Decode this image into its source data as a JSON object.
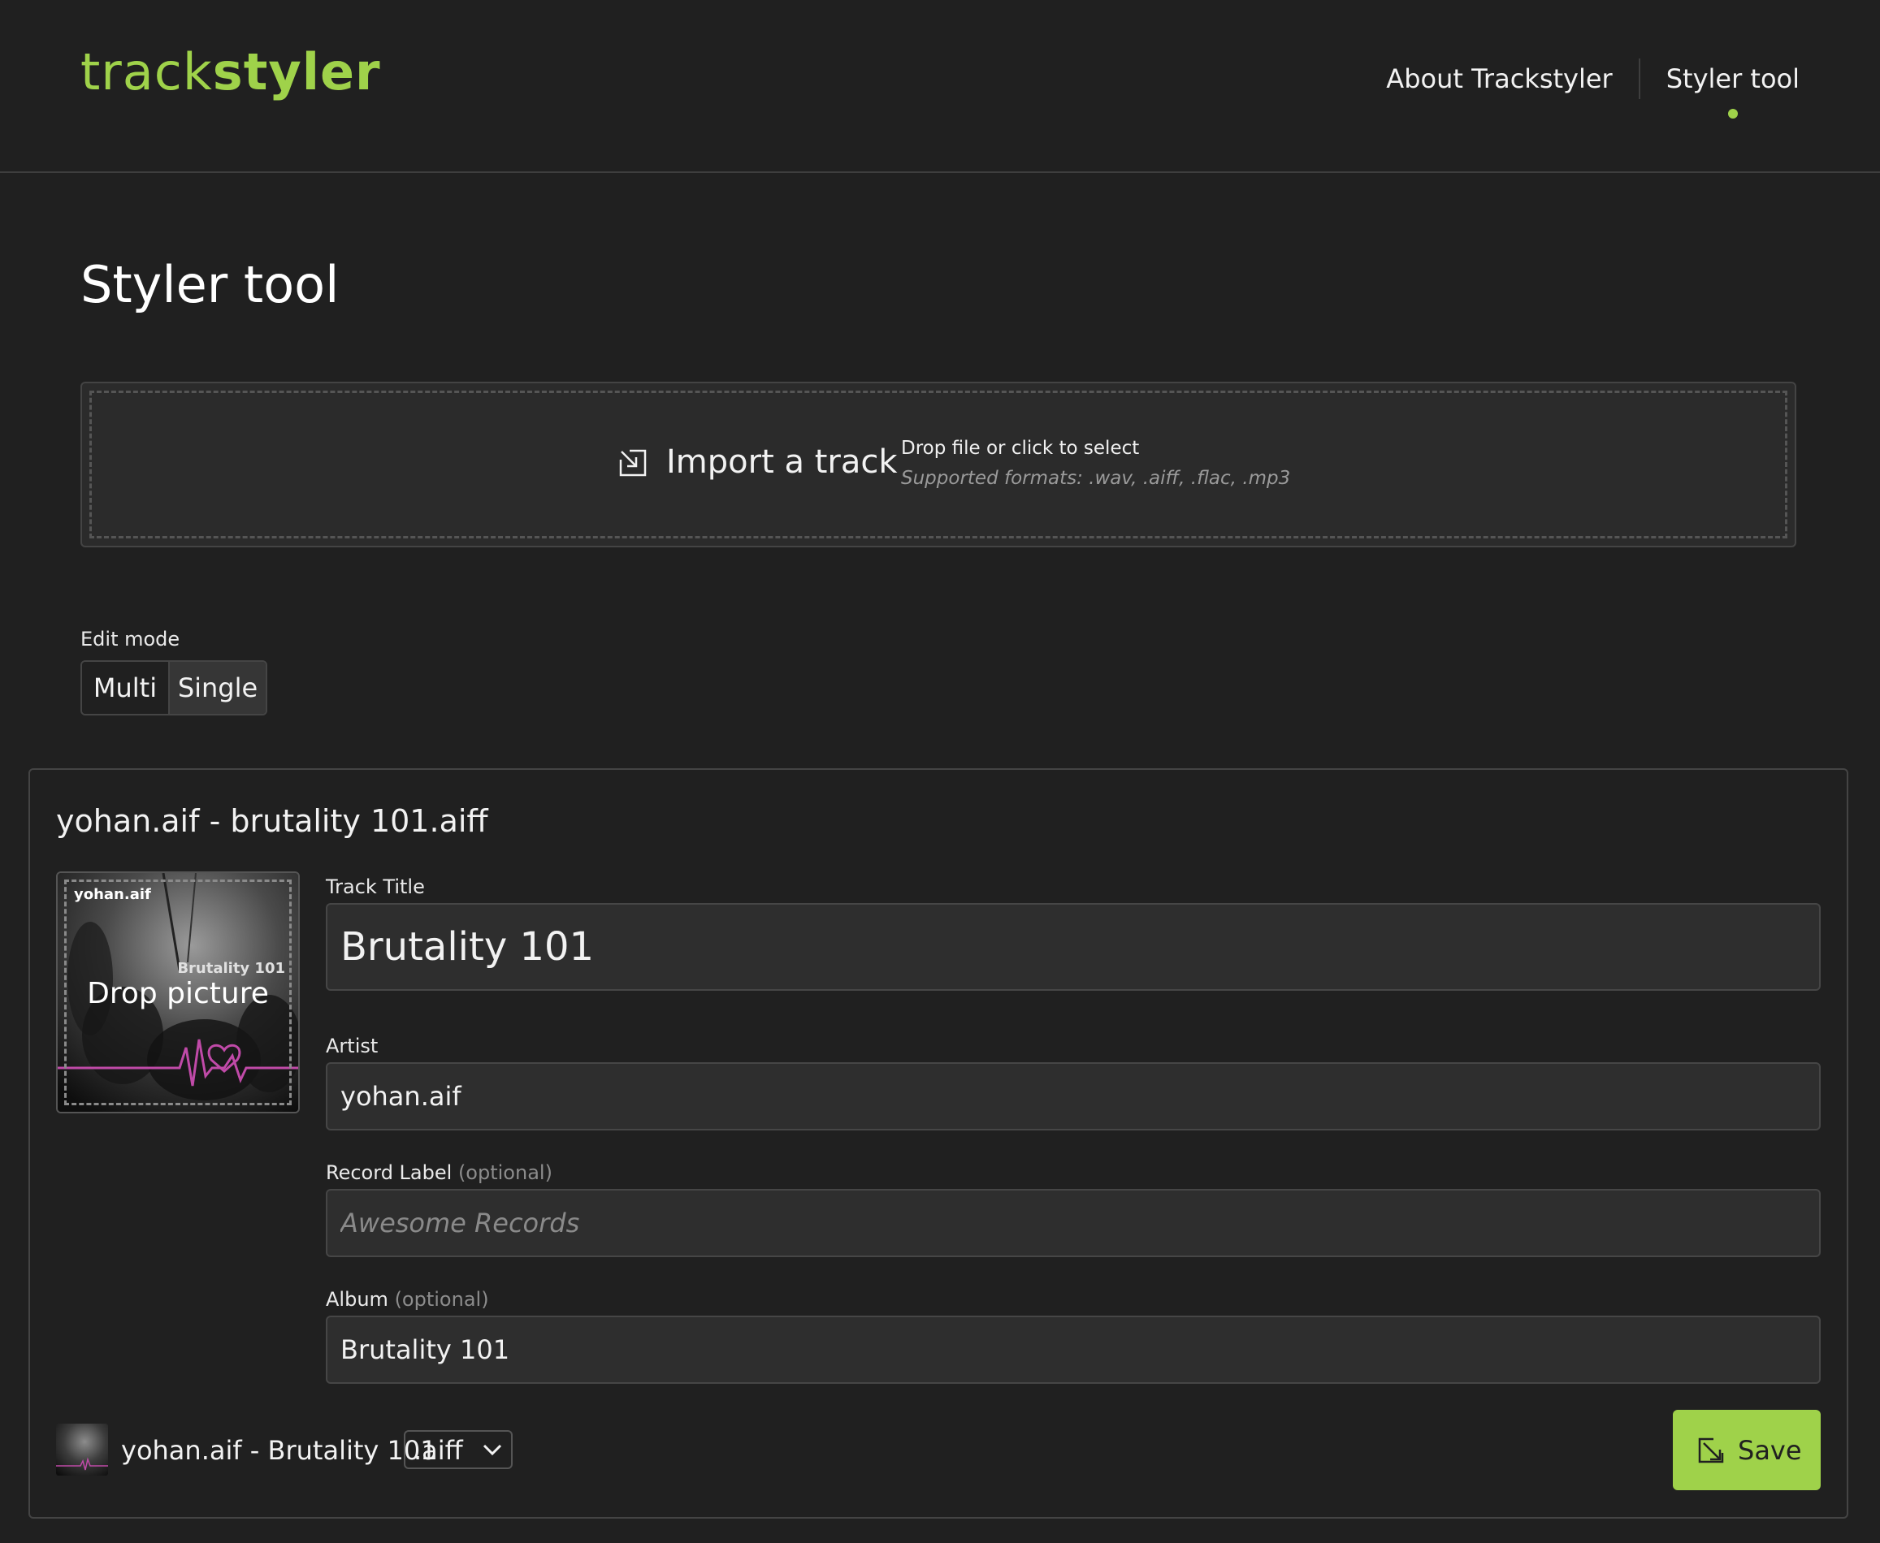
{
  "header": {
    "logo_light": "track",
    "logo_bold": "styler",
    "nav": [
      {
        "label": "About Trackstyler",
        "active": false
      },
      {
        "label": "Styler tool",
        "active": true
      }
    ],
    "accent_color": "#9fd24a"
  },
  "page": {
    "title": "Styler tool"
  },
  "import": {
    "icon": "import-icon",
    "label": "Import a track",
    "hint": "Drop file or click to select",
    "formats": "Supported formats: .wav, .aiff, .flac, .mp3"
  },
  "edit_mode": {
    "label": "Edit mode",
    "options": [
      "Multi",
      "Single"
    ],
    "selected": "Single"
  },
  "track": {
    "file_name": "yohan.aif - brutality 101.aiff",
    "cover": {
      "artist_text": "yohan.aif",
      "album_text": "Brutality 101",
      "drop_label": "Drop picture"
    },
    "fields": {
      "title": {
        "label": "Track Title",
        "value": "Brutality 101"
      },
      "artist": {
        "label": "Artist",
        "value": "yohan.aif"
      },
      "record_label": {
        "label": "Record Label",
        "optional": "(optional)",
        "placeholder": "Awesome Records",
        "value": ""
      },
      "album": {
        "label": "Album",
        "optional": "(optional)",
        "value": "Brutality 101"
      }
    },
    "footer": {
      "output_name": "yohan.aif - Brutality 101",
      "extension": ".aiff",
      "save_label": "Save"
    }
  }
}
